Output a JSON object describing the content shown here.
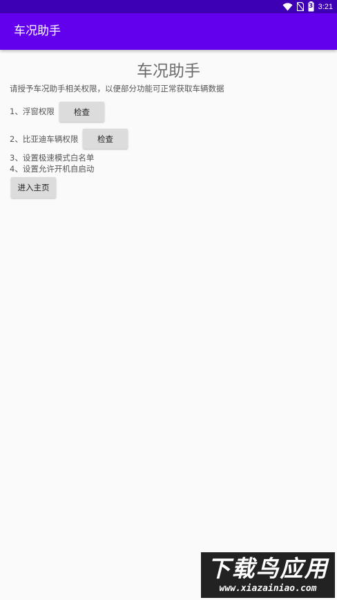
{
  "status_bar": {
    "time": "3:21",
    "battery_level": "3",
    "icons": [
      "wifi-icon",
      "sim-off-icon",
      "battery-icon"
    ]
  },
  "app_bar": {
    "title": "车况助手",
    "color": "#6200ee"
  },
  "content": {
    "title": "车况助手",
    "description": "请授予车况助手相关权限，以便部分功能可正常获取车辆数据",
    "items": [
      {
        "label": "1、浮窗权限",
        "button": "检查"
      },
      {
        "label": "2、比亚迪车辆权限",
        "button": "检查"
      },
      {
        "label": "3、设置极速模式白名单"
      },
      {
        "label": "4、设置允许开机自启动"
      }
    ],
    "enter_button": "进入主页"
  },
  "watermark": {
    "text": "下载鸟应用",
    "url": "www.xiazainiao.com"
  }
}
